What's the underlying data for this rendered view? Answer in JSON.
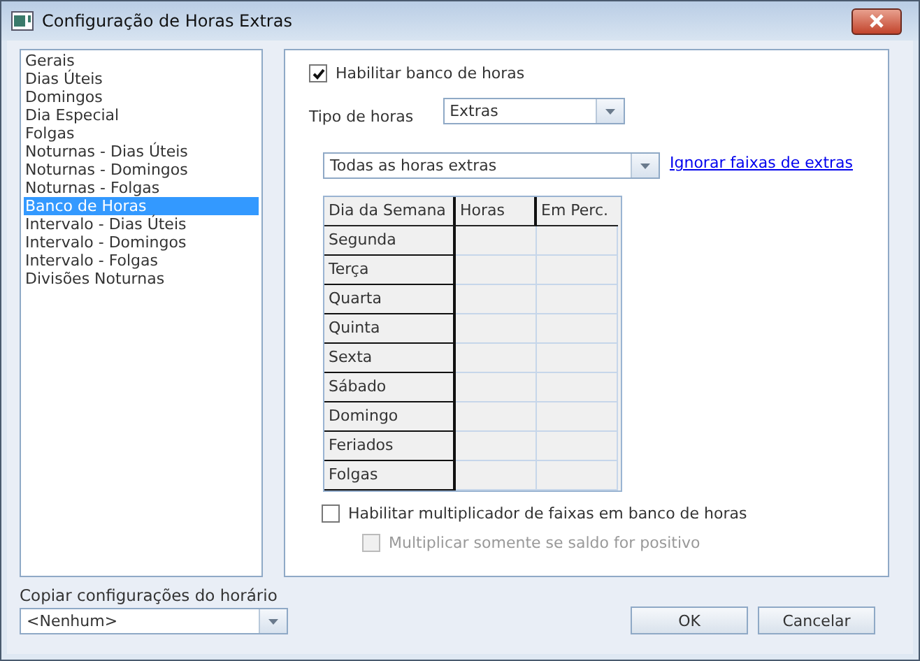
{
  "window": {
    "title": "Configuração de Horas Extras"
  },
  "sidebar": {
    "items": [
      {
        "label": "Gerais",
        "selected": false
      },
      {
        "label": "Dias Úteis",
        "selected": false
      },
      {
        "label": "Domingos",
        "selected": false
      },
      {
        "label": "Dia Especial",
        "selected": false
      },
      {
        "label": "Folgas",
        "selected": false
      },
      {
        "label": "Noturnas - Dias Úteis",
        "selected": false
      },
      {
        "label": "Noturnas - Domingos",
        "selected": false
      },
      {
        "label": "Noturnas - Folgas",
        "selected": false
      },
      {
        "label": "Banco de Horas",
        "selected": true
      },
      {
        "label": "Intervalo - Dias Úteis",
        "selected": false
      },
      {
        "label": "Intervalo - Domingos",
        "selected": false
      },
      {
        "label": "Intervalo - Folgas",
        "selected": false
      },
      {
        "label": "Divisões Noturnas",
        "selected": false
      }
    ]
  },
  "enable_bank": {
    "label": "Habilitar banco de horas",
    "checked": true,
    "disabled": false
  },
  "hour_type": {
    "label": "Tipo de horas",
    "value": "Extras"
  },
  "range": {
    "value": "Todas as horas extras"
  },
  "ignore_link": "Ignorar faixas de extras",
  "table": {
    "columns": [
      "Dia da Semana",
      "Horas",
      "Em Perc."
    ],
    "rows": [
      "Segunda",
      "Terça",
      "Quarta",
      "Quinta",
      "Sexta",
      "Sábado",
      "Domingo",
      "Feriados",
      "Folgas"
    ]
  },
  "multiplier": {
    "label": "Habilitar multiplicador de faixas em banco de horas",
    "checked": false,
    "disabled": false
  },
  "positive_only": {
    "label": "Multiplicar somente se saldo for positivo",
    "checked": false,
    "disabled": true
  },
  "copy": {
    "label": "Copiar configurações do horário",
    "value": "<Nenhum>"
  },
  "buttons": [
    "OK",
    "Cancelar"
  ]
}
